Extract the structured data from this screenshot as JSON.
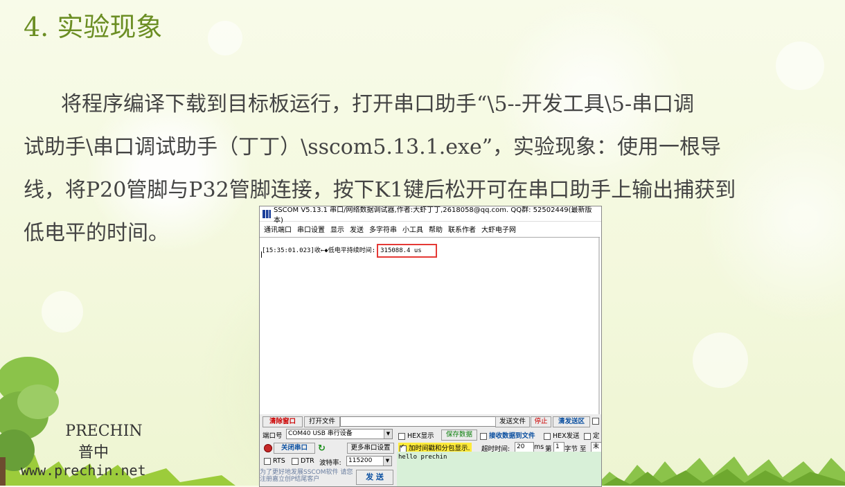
{
  "slide": {
    "title": "4. 实验现象",
    "paragraph_lines": [
      "将程序编译下载到目标板运行，打开串口助手“\\5--开发工具\\5-串口调",
      "试助手\\串口调试助手（丁丁）\\sscom5.13.1.exe”，实验现象：使用一根导",
      "线，将P20管脚与P32管脚连接，按下K1键后松开可在串口助手上输出捕获到",
      "低电平的时间。"
    ]
  },
  "logo": {
    "en": "PRECHIN",
    "cn": "普中",
    "url": "www.prechin.net"
  },
  "sscom": {
    "title": "SSCOM V5.13.1 串口/网络数据调试器,作者:大虾丁丁,2618058@qq.com. QQ群: 52502449(最新版本)",
    "menu": [
      "通讯端口",
      "串口设置",
      "显示",
      "发送",
      "多字符串",
      "小工具",
      "帮助",
      "联系作者",
      "大虾电子网"
    ],
    "receive": {
      "prefix": "[15:35:01.023]收←◆低电平持续时间:",
      "value": "315088.4 us"
    },
    "toolbar": {
      "clear_window": "清除窗口",
      "open_file": "打开文件",
      "send_file": "发送文件",
      "stop": "停止",
      "clear_send": "清发送区",
      "hex_display": "HEX显示",
      "save_data": "保存数据",
      "recv_to_file": "接收数据到文件",
      "hex_send": "HEX发送",
      "fixed": "定"
    },
    "port": {
      "port_label": "端口号",
      "port_value": "COM40 USB 串行设备",
      "more_settings": "更多串口设置",
      "timestamp_label": "加时间戳和分包显示.",
      "timeout_label": "超时时间:",
      "timeout_value": "20",
      "ms": "ms",
      "nth": "第",
      "nth_value": "1",
      "byte_label": "字节 至",
      "end_label": "末",
      "close_port": "关闭串口",
      "rts": "RTS",
      "dtr": "DTR",
      "baud_label": "波特率:",
      "baud_value": "115200",
      "send_text": "hello prechin",
      "send_button": "发 送",
      "promo": "为了更好地发展SSCOM软件 请您注册嘉立创P结尾客户"
    }
  }
}
